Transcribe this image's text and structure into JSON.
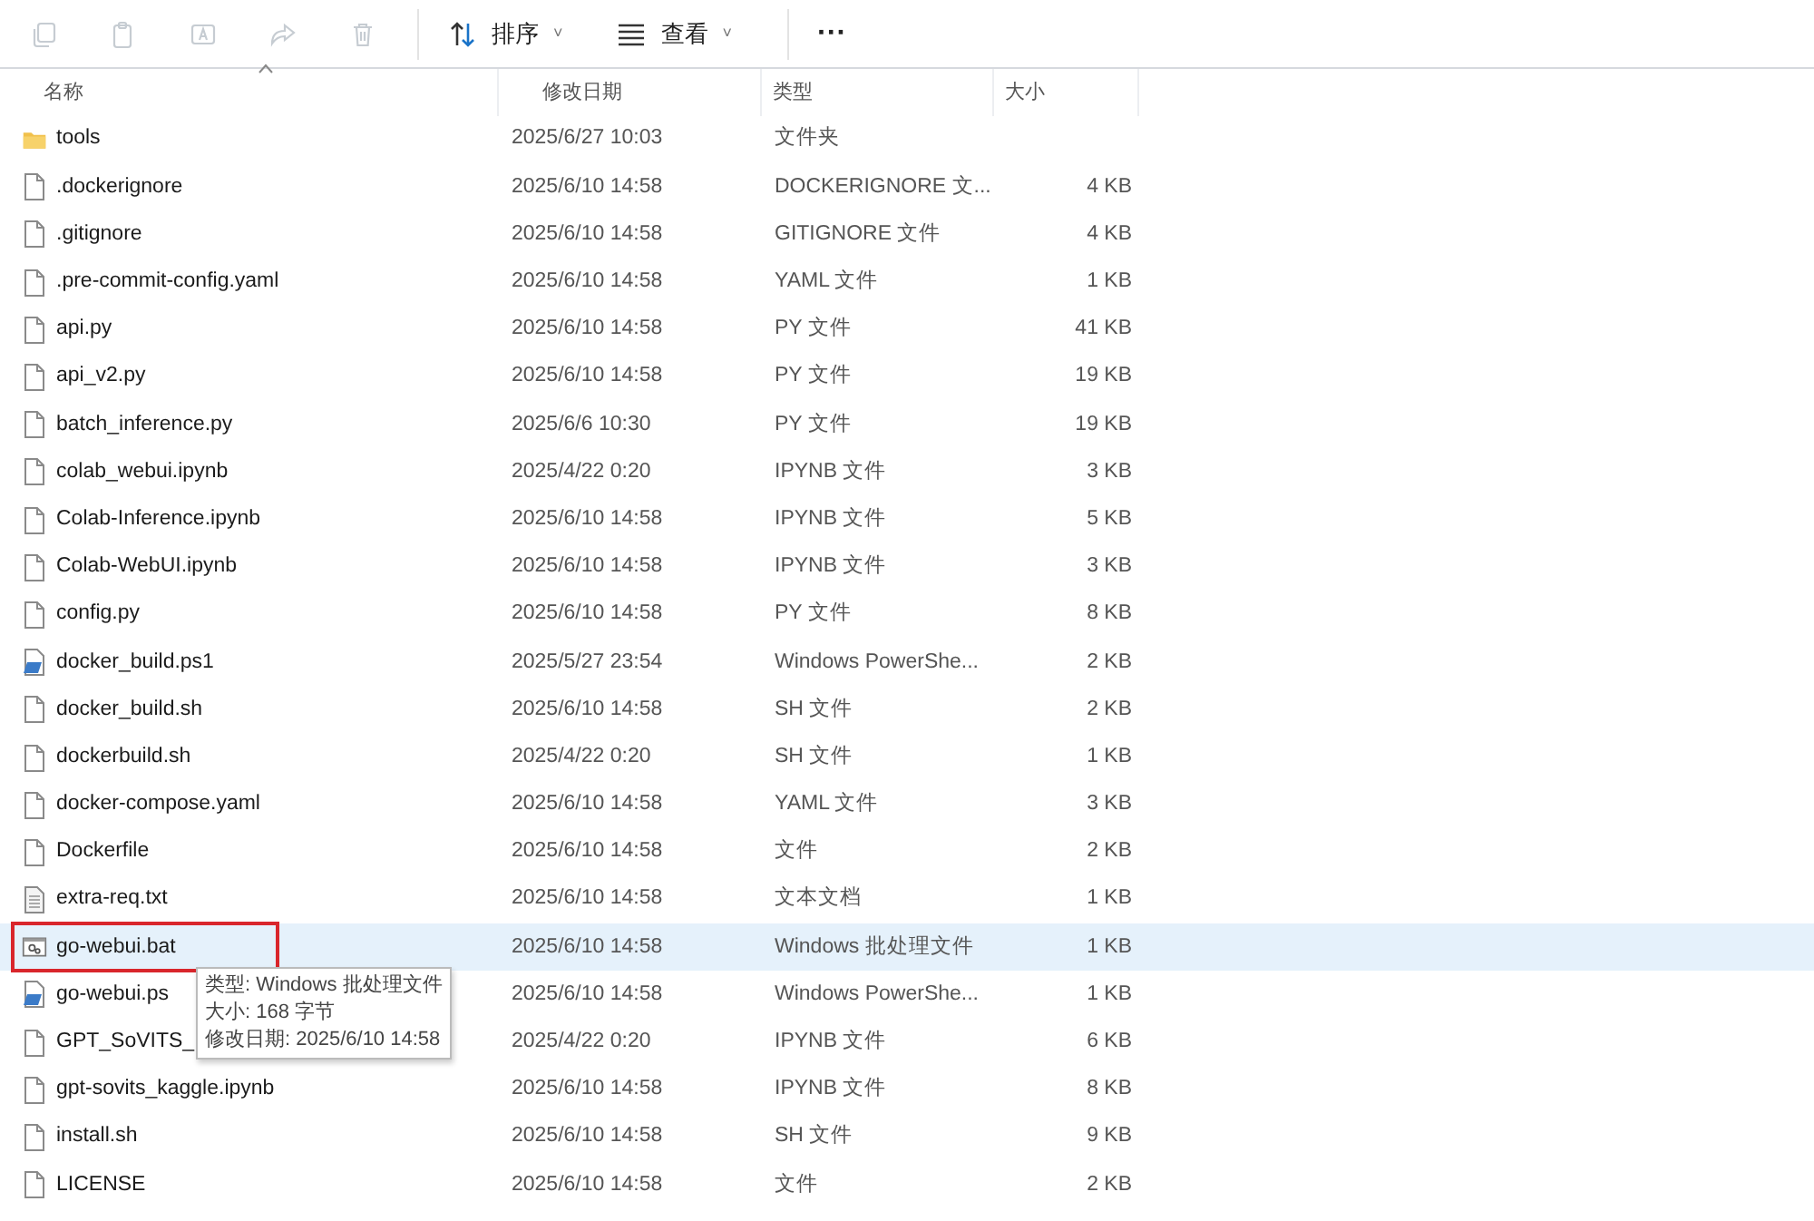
{
  "toolbar": {
    "actions": [
      {
        "kind": "copy",
        "disabled": true
      },
      {
        "kind": "paste",
        "disabled": true
      },
      {
        "kind": "rename",
        "disabled": true
      },
      {
        "kind": "share",
        "disabled": true
      },
      {
        "kind": "delete",
        "disabled": true
      }
    ],
    "sort": {
      "label": "排序",
      "chevron": "˅"
    },
    "view": {
      "label": "查看",
      "chevron": "˅"
    },
    "more": "···"
  },
  "columns": [
    {
      "label": "名称",
      "sorted": true
    },
    {
      "label": "修改日期",
      "sorted": false
    },
    {
      "label": "类型",
      "sorted": false
    },
    {
      "label": "大小",
      "sorted": false
    }
  ],
  "files": [
    {
      "kind": "folder",
      "name": "tools",
      "modified": "2025/6/27 10:03",
      "type": "文件夹",
      "selected": false,
      "outlined": false
    },
    {
      "kind": "file",
      "name": ".dockerignore",
      "modified": "2025/6/10 14:58",
      "type": "DOCKERIGNORE 文...",
      "size": "4 KB",
      "selected": false,
      "outlined": false
    },
    {
      "kind": "file",
      "name": ".gitignore",
      "modified": "2025/6/10 14:58",
      "type": "GITIGNORE 文件",
      "size": "4 KB",
      "selected": false,
      "outlined": false
    },
    {
      "kind": "file",
      "name": ".pre-commit-config.yaml",
      "modified": "2025/6/10 14:58",
      "type": "YAML 文件",
      "size": "1 KB",
      "selected": false,
      "outlined": false
    },
    {
      "kind": "file",
      "name": "api.py",
      "modified": "2025/6/10 14:58",
      "type": "PY 文件",
      "size": "41 KB",
      "selected": false,
      "outlined": false
    },
    {
      "kind": "file",
      "name": "api_v2.py",
      "modified": "2025/6/10 14:58",
      "type": "PY 文件",
      "size": "19 KB",
      "selected": false,
      "outlined": false
    },
    {
      "kind": "file",
      "name": "batch_inference.py",
      "modified": "2025/6/6 10:30",
      "type": "PY 文件",
      "size": "19 KB",
      "selected": false,
      "outlined": false
    },
    {
      "kind": "file",
      "name": "colab_webui.ipynb",
      "modified": "2025/4/22 0:20",
      "type": "IPYNB 文件",
      "size": "3 KB",
      "selected": false,
      "outlined": false
    },
    {
      "kind": "file",
      "name": "Colab-Inference.ipynb",
      "modified": "2025/6/10 14:58",
      "type": "IPYNB 文件",
      "size": "5 KB",
      "selected": false,
      "outlined": false
    },
    {
      "kind": "file",
      "name": "Colab-WebUI.ipynb",
      "modified": "2025/6/10 14:58",
      "type": "IPYNB 文件",
      "size": "3 KB",
      "selected": false,
      "outlined": false
    },
    {
      "kind": "file",
      "name": "config.py",
      "modified": "2025/6/10 14:58",
      "type": "PY 文件",
      "size": "8 KB",
      "selected": false,
      "outlined": false
    },
    {
      "kind": "script",
      "name": "docker_build.ps1",
      "modified": "2025/5/27 23:54",
      "type": "Windows PowerShe...",
      "size": "2 KB",
      "selected": false,
      "outlined": false
    },
    {
      "kind": "file",
      "name": "docker_build.sh",
      "modified": "2025/6/10 14:58",
      "type": "SH 文件",
      "size": "2 KB",
      "selected": false,
      "outlined": false
    },
    {
      "kind": "file",
      "name": "dockerbuild.sh",
      "modified": "2025/4/22 0:20",
      "type": "SH 文件",
      "size": "1 KB",
      "selected": false,
      "outlined": false
    },
    {
      "kind": "file",
      "name": "docker-compose.yaml",
      "modified": "2025/6/10 14:58",
      "type": "YAML 文件",
      "size": "3 KB",
      "selected": false,
      "outlined": false
    },
    {
      "kind": "file",
      "name": "Dockerfile",
      "modified": "2025/6/10 14:58",
      "type": "文件",
      "size": "2 KB",
      "selected": false,
      "outlined": false
    },
    {
      "kind": "text",
      "name": "extra-req.txt",
      "modified": "2025/6/10 14:58",
      "type": "文本文档",
      "size": "1 KB",
      "selected": false,
      "outlined": false
    },
    {
      "kind": "batch",
      "name": "go-webui.bat",
      "modified": "2025/6/10 14:58",
      "type": "Windows 批处理文件",
      "size": "1 KB",
      "selected": true,
      "outlined": true,
      "tooltip": [
        "类型: Windows 批处理文件",
        "大小: 168 字节",
        "修改日期: 2025/6/10 14:58"
      ]
    },
    {
      "kind": "script",
      "name": "go-webui.ps",
      "modified": "2025/6/10 14:58",
      "type": "Windows PowerShe...",
      "size": "1 KB",
      "selected": false,
      "outlined": false
    },
    {
      "kind": "file",
      "name": "GPT_SoVITS_",
      "modified": "2025/4/22 0:20",
      "type": "IPYNB 文件",
      "size": "6 KB",
      "selected": false,
      "outlined": false
    },
    {
      "kind": "file",
      "name": "gpt-sovits_kaggle.ipynb",
      "modified": "2025/6/10 14:58",
      "type": "IPYNB 文件",
      "size": "8 KB",
      "selected": false,
      "outlined": false
    },
    {
      "kind": "file",
      "name": "install.sh",
      "modified": "2025/6/10 14:58",
      "type": "SH 文件",
      "size": "9 KB",
      "selected": false,
      "outlined": false
    },
    {
      "kind": "file",
      "name": "LICENSE",
      "modified": "2025/6/10 14:58",
      "type": "文件",
      "size": "2 KB",
      "selected": false,
      "outlined": false
    }
  ]
}
